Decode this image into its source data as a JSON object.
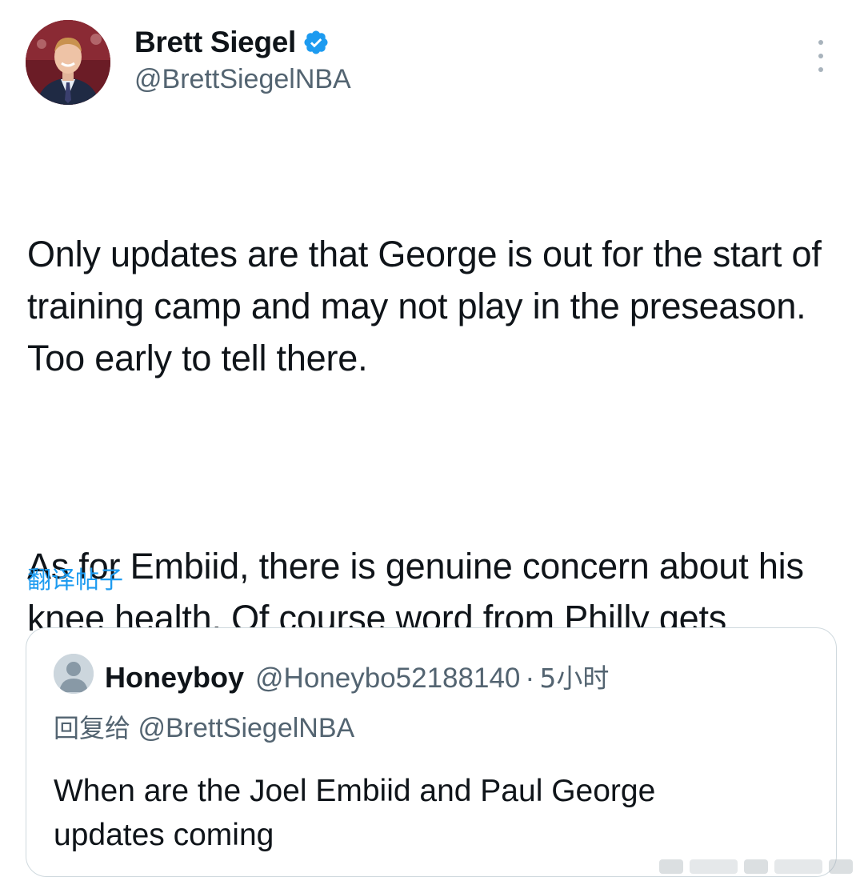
{
  "author": {
    "name": "Brett Siegel",
    "handle": "@BrettSiegelNBA",
    "verified": true
  },
  "tweet": {
    "paragraphs": [
      "Only updates are that George is out for the start of training camp and may not play in the preseason. Too early to tell there.",
      "As for Embiid, there is genuine concern about his knee health. Of course word from Philly gets downplayed, but around the league, word is bad."
    ],
    "translate_label": "翻译帖子"
  },
  "quote": {
    "name": "Honeyboy",
    "handle": "@Honeybo52188140",
    "separator": "·",
    "time": "5小时",
    "reply_prefix": "回复给",
    "reply_handle": "@BrettSiegelNBA",
    "text": "When are the Joel Embiid and Paul George updates coming"
  },
  "colors": {
    "accent": "#1d9bf0",
    "secondary_text": "#536471",
    "border": "#cfd9de"
  },
  "icons": [
    "verified-icon",
    "more-options-icon",
    "default-avatar-icon"
  ]
}
